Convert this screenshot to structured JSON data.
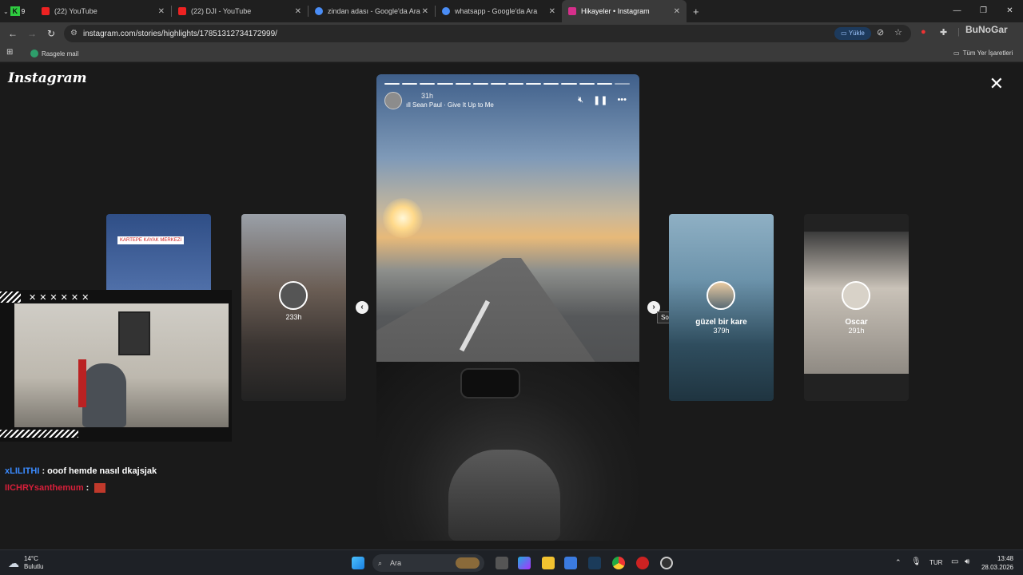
{
  "browser": {
    "tabs": [
      {
        "title": "(22) YouTube",
        "color": "#e22"
      },
      {
        "title": "(22) DJI - YouTube",
        "color": "#e22"
      },
      {
        "title": "zindan adası - Google'da Ara",
        "color": "#4a8df6"
      },
      {
        "title": "whatsapp - Google'da Ara",
        "color": "#4a8df6"
      },
      {
        "title": "Hikayeler • Instagram",
        "color": "#d62f8b"
      }
    ],
    "new_tab": "+",
    "url": "instagram.com/stories/highlights/17851312734172999/",
    "upload_button": "Yükle",
    "bookmark_item": "Rasgele mail",
    "all_bookmarks": "Tüm Yer İşaretleri",
    "profile_text": "BuNoGar"
  },
  "instagram": {
    "logo": "Instagram",
    "story": {
      "time": "31h",
      "music": "Sean Paul · Give It Up to Me",
      "segments_total": 14,
      "segments_done": 13
    },
    "cards": [
      {
        "title": "",
        "time": "",
        "banner": "KARTEPE KAYAK MERKEZİ"
      },
      {
        "title": "",
        "time": "233h",
        "banner": ""
      },
      {
        "title": "güzel bir kare",
        "time": "379h",
        "banner": ""
      },
      {
        "title": "Oscar",
        "time": "291h",
        "banner": ""
      }
    ],
    "next_tooltip": "Sonraki"
  },
  "overlay": {
    "chat": [
      {
        "user": "xLILITHI",
        "message": " : ooof hemde nasıl dkajsjak",
        "color": "#3b8bff"
      },
      {
        "user": "IICHRYsanthemum",
        "message": " :",
        "color": "#d81f3a"
      }
    ]
  },
  "taskbar": {
    "weather_temp": "14°C",
    "weather_desc": "Bulutlu",
    "search_label": "Ara",
    "lang": "TUR",
    "time": "13:48",
    "date": "28.03.2026"
  }
}
